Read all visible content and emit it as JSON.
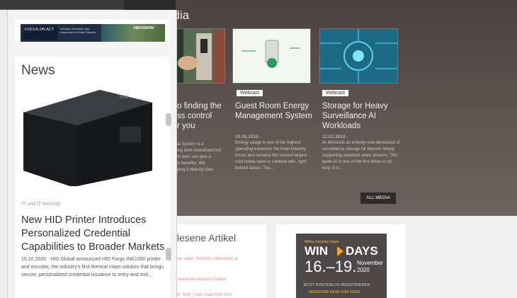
{
  "media": {
    "title": "edia",
    "cards": [
      {
        "badge": "",
        "title": "o finding the\nss control\nr you",
        "date": "",
        "text": "al System is a\ning term investment but\nm well, can give a\nis benefits. We\nping it step-by-step"
      },
      {
        "badge": "Webcast",
        "title": "Guest Room Energy Management System",
        "date": "03.05.2019 -",
        "text": "Energy usage is one of the highest operating expenses the hotel industry incurs and remains the second largest cost hotels have to contend with, right behind labour. The…"
      },
      {
        "badge": "Webcast",
        "title": "Storage for Heavy Surveillance AI Workloads",
        "date": "22.02.2019 -",
        "text": "AI demands an entirely new dimension of surveillance storage far beyond simply supporting standard video streams. This week AI is one of the first drives in its kind. It is…"
      }
    ],
    "all_media_label": "ALL MEDIA"
  },
  "articles": {
    "title": "elesene Artikel",
    "links": [
      "ene safer: Security conference at",
      "Hautstrafecompany Gainer",
      "Ihr Tech / Gets Data Hub Ston"
    ]
  },
  "ad": {
    "top": "Wiley Industry Days",
    "win": "WIN",
    "days": "DAYS",
    "dates": "16.–19.",
    "month": "November",
    "year": "2020",
    "cta1": "JETZT KOSTENLOS REGISTRIEREN",
    "cta2": "REGISTER NOW FOR FREE"
  },
  "sidebar": {
    "banner": {
      "left_text": "FOCUS ON ACT",
      "middle_text": "Intrusion Detection and Inspection for Better Results",
      "brand": "HIKVISION"
    },
    "news": {
      "title": "News",
      "category": "IT und IT-Security",
      "headline": "New HID Printer Introduces Personalized Credential Capabilities to Broader Markets",
      "meta": "15.10.2020 · HID Global announced HID Fargo INK1000 printer and encoder, the industry's first thermal inkjet solution that brings secure, personalized credential issuance to entry-and mid…"
    }
  },
  "colors": {
    "media_bg": "#4b4241",
    "accent": "#f5a623",
    "category": "#b388a8"
  }
}
